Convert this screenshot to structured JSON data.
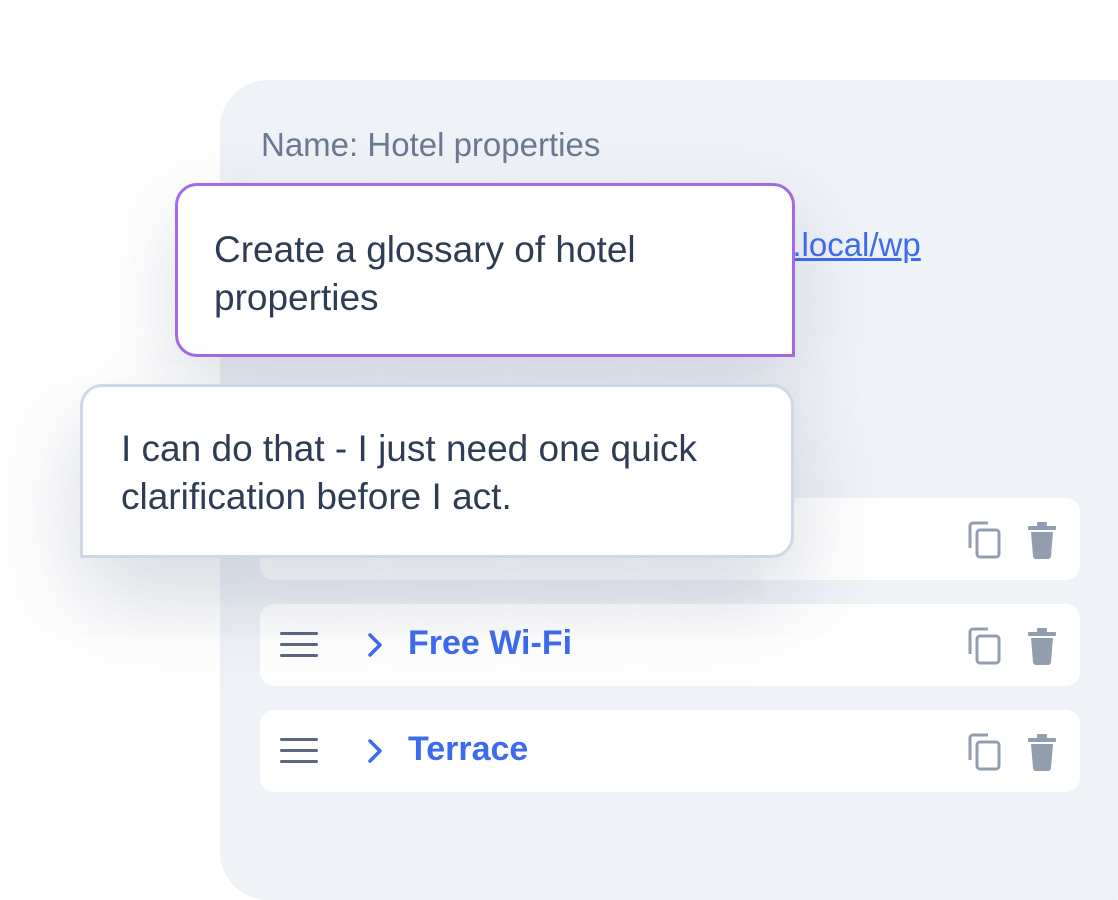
{
  "panel": {
    "name_line": "Name: Hotel properties",
    "url_fragment": "e.local/wp"
  },
  "chat": {
    "user_message": "Create a glossary of hotel properties",
    "assistant_message": "I can do that - I just need one quick clarification before I act."
  },
  "rows": [
    {
      "label": ""
    },
    {
      "label": "Free Wi-Fi"
    },
    {
      "label": "Terrace"
    }
  ],
  "icons": {
    "drag": "drag-handle-icon",
    "expand": "chevron-right-icon",
    "duplicate": "copy-icon",
    "delete": "trash-icon"
  },
  "colors": {
    "accent": "#3d6bf0",
    "user_bubble_border": "#a46ae6",
    "icon_gray": "#939db0"
  }
}
